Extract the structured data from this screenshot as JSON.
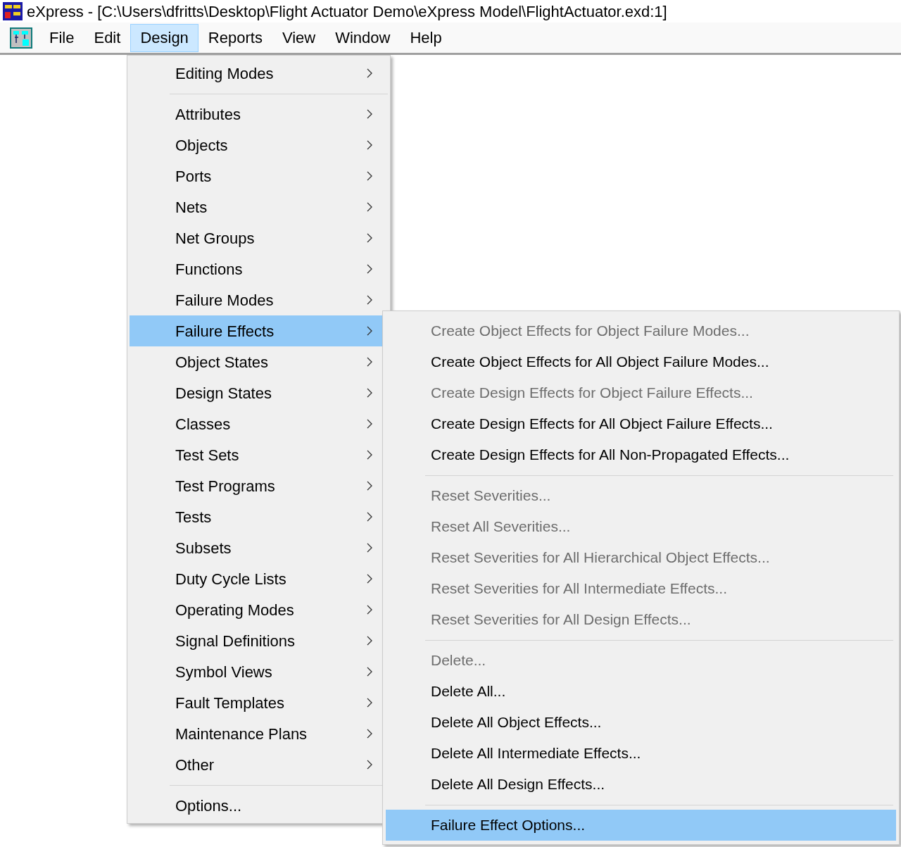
{
  "window": {
    "title": "eXpress - [C:\\Users\\dfritts\\Desktop\\Flight Actuator Demo\\eXpress Model\\FlightActuator.exd:1]"
  },
  "menu_bar": [
    {
      "label": "File",
      "selected": false
    },
    {
      "label": "Edit",
      "selected": false
    },
    {
      "label": "Design",
      "selected": true
    },
    {
      "label": "Reports",
      "selected": false
    },
    {
      "label": "View",
      "selected": false
    },
    {
      "label": "Window",
      "selected": false
    },
    {
      "label": "Help",
      "selected": false
    }
  ],
  "design_menu": [
    {
      "kind": "item",
      "label": "Editing Modes",
      "submenu": true,
      "selected": false
    },
    {
      "kind": "separator"
    },
    {
      "kind": "item",
      "label": "Attributes",
      "submenu": true,
      "selected": false
    },
    {
      "kind": "item",
      "label": "Objects",
      "submenu": true,
      "selected": false
    },
    {
      "kind": "item",
      "label": "Ports",
      "submenu": true,
      "selected": false
    },
    {
      "kind": "item",
      "label": "Nets",
      "submenu": true,
      "selected": false
    },
    {
      "kind": "item",
      "label": "Net Groups",
      "submenu": true,
      "selected": false
    },
    {
      "kind": "item",
      "label": "Functions",
      "submenu": true,
      "selected": false
    },
    {
      "kind": "item",
      "label": "Failure Modes",
      "submenu": true,
      "selected": false
    },
    {
      "kind": "item",
      "label": "Failure Effects",
      "submenu": true,
      "selected": true
    },
    {
      "kind": "item",
      "label": "Object States",
      "submenu": true,
      "selected": false
    },
    {
      "kind": "item",
      "label": "Design States",
      "submenu": true,
      "selected": false
    },
    {
      "kind": "item",
      "label": "Classes",
      "submenu": true,
      "selected": false
    },
    {
      "kind": "item",
      "label": "Test Sets",
      "submenu": true,
      "selected": false
    },
    {
      "kind": "item",
      "label": "Test Programs",
      "submenu": true,
      "selected": false
    },
    {
      "kind": "item",
      "label": "Tests",
      "submenu": true,
      "selected": false
    },
    {
      "kind": "item",
      "label": "Subsets",
      "submenu": true,
      "selected": false
    },
    {
      "kind": "item",
      "label": "Duty Cycle Lists",
      "submenu": true,
      "selected": false
    },
    {
      "kind": "item",
      "label": "Operating Modes",
      "submenu": true,
      "selected": false
    },
    {
      "kind": "item",
      "label": "Signal Definitions",
      "submenu": true,
      "selected": false
    },
    {
      "kind": "item",
      "label": "Symbol Views",
      "submenu": true,
      "selected": false
    },
    {
      "kind": "item",
      "label": "Fault Templates",
      "submenu": true,
      "selected": false
    },
    {
      "kind": "item",
      "label": "Maintenance Plans",
      "submenu": true,
      "selected": false
    },
    {
      "kind": "item",
      "label": "Other",
      "submenu": true,
      "selected": false
    },
    {
      "kind": "separator"
    },
    {
      "kind": "item",
      "label": "Options...",
      "submenu": false,
      "selected": false
    }
  ],
  "failure_effects_menu": [
    {
      "kind": "item",
      "label": "Create Object Effects for Object Failure Modes...",
      "disabled": true,
      "selected": false
    },
    {
      "kind": "item",
      "label": "Create Object Effects for All Object Failure Modes...",
      "disabled": false,
      "selected": false
    },
    {
      "kind": "item",
      "label": "Create Design Effects for Object Failure Effects...",
      "disabled": true,
      "selected": false
    },
    {
      "kind": "item",
      "label": "Create Design Effects for All Object Failure Effects...",
      "disabled": false,
      "selected": false
    },
    {
      "kind": "item",
      "label": "Create Design Effects for All Non-Propagated Effects...",
      "disabled": false,
      "selected": false
    },
    {
      "kind": "separator"
    },
    {
      "kind": "item",
      "label": "Reset Severities...",
      "disabled": true,
      "selected": false
    },
    {
      "kind": "item",
      "label": "Reset All Severities...",
      "disabled": true,
      "selected": false
    },
    {
      "kind": "item",
      "label": "Reset Severities for All Hierarchical Object Effects...",
      "disabled": true,
      "selected": false
    },
    {
      "kind": "item",
      "label": "Reset Severities for All Intermediate Effects...",
      "disabled": true,
      "selected": false
    },
    {
      "kind": "item",
      "label": "Reset Severities for All Design Effects...",
      "disabled": true,
      "selected": false
    },
    {
      "kind": "separator"
    },
    {
      "kind": "item",
      "label": "Delete...",
      "disabled": true,
      "selected": false
    },
    {
      "kind": "item",
      "label": "Delete All...",
      "disabled": false,
      "selected": false
    },
    {
      "kind": "item",
      "label": "Delete All Object Effects...",
      "disabled": false,
      "selected": false
    },
    {
      "kind": "item",
      "label": "Delete All Intermediate Effects...",
      "disabled": false,
      "selected": false
    },
    {
      "kind": "item",
      "label": "Delete All Design Effects...",
      "disabled": false,
      "selected": false
    },
    {
      "kind": "separator"
    },
    {
      "kind": "item",
      "label": "Failure Effect Options...",
      "disabled": false,
      "selected": true
    }
  ]
}
